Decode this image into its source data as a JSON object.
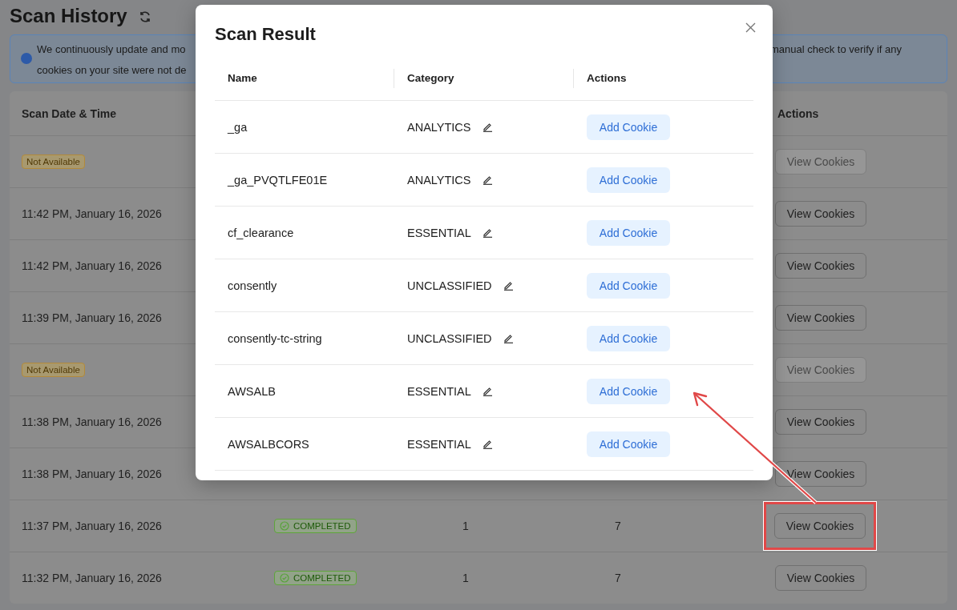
{
  "page": {
    "title": "Scan History",
    "info_banner": {
      "line_1_start": "We continuously update and mo",
      "line_1_end": "manual check to verify if any",
      "line_2_start": "cookies on your site were not de"
    }
  },
  "history_table": {
    "column_1": "Scan Date & Time",
    "column_5": "Actions",
    "rows": [
      {
        "kind": "badge",
        "scan_time": "Not Available",
        "action": "View Cookies",
        "disabled": true,
        "highlighted": false
      },
      {
        "kind": "time",
        "scan_time": "11:42 PM, January 16, 2026",
        "action": "View Cookies",
        "disabled": false,
        "highlighted": false
      },
      {
        "kind": "time",
        "scan_time": "11:42 PM, January 16, 2026",
        "action": "View Cookies",
        "disabled": false,
        "highlighted": false
      },
      {
        "kind": "time",
        "scan_time": "11:39 PM, January 16, 2026",
        "action": "View Cookies",
        "disabled": false,
        "highlighted": false
      },
      {
        "kind": "badge",
        "scan_time": "Not Available",
        "action": "View Cookies",
        "disabled": true,
        "highlighted": false
      },
      {
        "kind": "time",
        "scan_time": "11:38 PM, January 16, 2026",
        "action": "View Cookies",
        "disabled": false,
        "highlighted": false
      },
      {
        "kind": "time",
        "scan_time": "11:38 PM, January 16, 2026",
        "action": "View Cookies",
        "disabled": false,
        "highlighted": false
      },
      {
        "kind": "time",
        "scan_time": "11:37 PM, January 16, 2026",
        "status": "COMPLETED",
        "column_3": "1",
        "column_4": "7",
        "action": "View Cookies",
        "disabled": false,
        "highlighted": true
      },
      {
        "kind": "time",
        "scan_time": "11:32 PM, January 16, 2026",
        "status": "COMPLETED",
        "column_3": "1",
        "column_4": "7",
        "action": "View Cookies",
        "disabled": false,
        "highlighted": false
      }
    ]
  },
  "modal": {
    "title": "Scan Result",
    "columns": [
      "Name",
      "Category",
      "Actions"
    ],
    "rows": [
      {
        "name": "_ga",
        "category": "ANALYTICS",
        "action": "Add Cookie"
      },
      {
        "name": "_ga_PVQTLFE01E",
        "category": "ANALYTICS",
        "action": "Add Cookie"
      },
      {
        "name": "cf_clearance",
        "category": "ESSENTIAL",
        "action": "Add Cookie"
      },
      {
        "name": "consently",
        "category": "UNCLASSIFIED",
        "action": "Add Cookie"
      },
      {
        "name": "consently-tc-string",
        "category": "UNCLASSIFIED",
        "action": "Add Cookie"
      },
      {
        "name": "AWSALB",
        "category": "ESSENTIAL",
        "action": "Add Cookie"
      },
      {
        "name": "AWSALBCORS",
        "category": "ESSENTIAL",
        "action": "Add Cookie"
      }
    ]
  }
}
